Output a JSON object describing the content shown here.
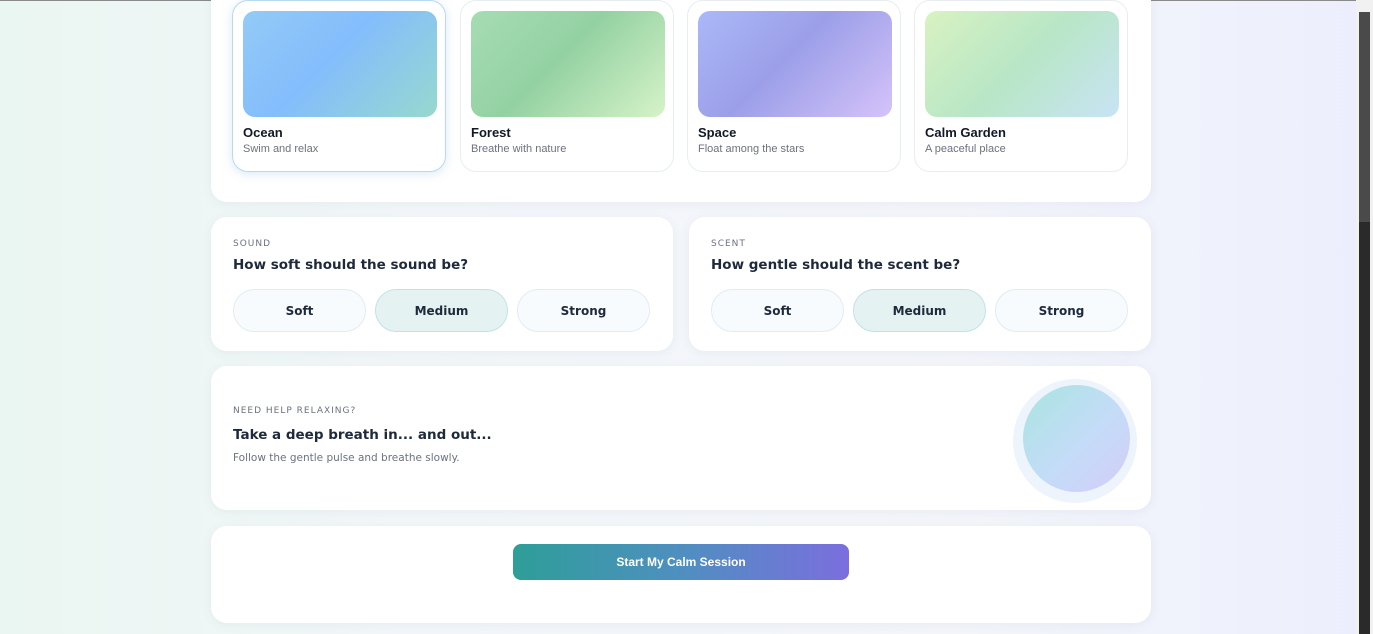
{
  "themes": [
    {
      "title": "Ocean",
      "subtitle": "Swim and relax",
      "selected": true,
      "gradient": [
        "#92cbf6",
        "#84bdfc",
        "#97d9cf"
      ]
    },
    {
      "title": "Forest",
      "subtitle": "Breathe with nature",
      "selected": false,
      "gradient": [
        "#a7dcb4",
        "#93d1a2",
        "#d6f3c8"
      ]
    },
    {
      "title": "Space",
      "subtitle": "Float among the stars",
      "selected": false,
      "gradient": [
        "#aab8f8",
        "#9c9fe8",
        "#d5c3fa"
      ]
    },
    {
      "title": "Calm Garden",
      "subtitle": "A peaceful place",
      "selected": false,
      "gradient": [
        "#d9f2c2",
        "#b8e6c6",
        "#c8e4f5"
      ]
    }
  ],
  "sound": {
    "eyebrow": "SOUND",
    "question": "How soft should the sound be?",
    "options": [
      "Soft",
      "Medium",
      "Strong"
    ],
    "selected": "Medium"
  },
  "scent": {
    "eyebrow": "SCENT",
    "question": "How gentle should the scent be?",
    "options": [
      "Soft",
      "Medium",
      "Strong"
    ],
    "selected": "Medium"
  },
  "breathe": {
    "eyebrow": "NEED HELP RELAXING?",
    "title": "Take a deep breath in... and out...",
    "description": "Follow the gentle pulse and breathe slowly."
  },
  "start": {
    "label": "Start My Calm Session"
  },
  "colors": {
    "accent_start": "#2e9e98",
    "accent_end": "#7b6ede",
    "selected_pill": "#e4f3f2"
  }
}
